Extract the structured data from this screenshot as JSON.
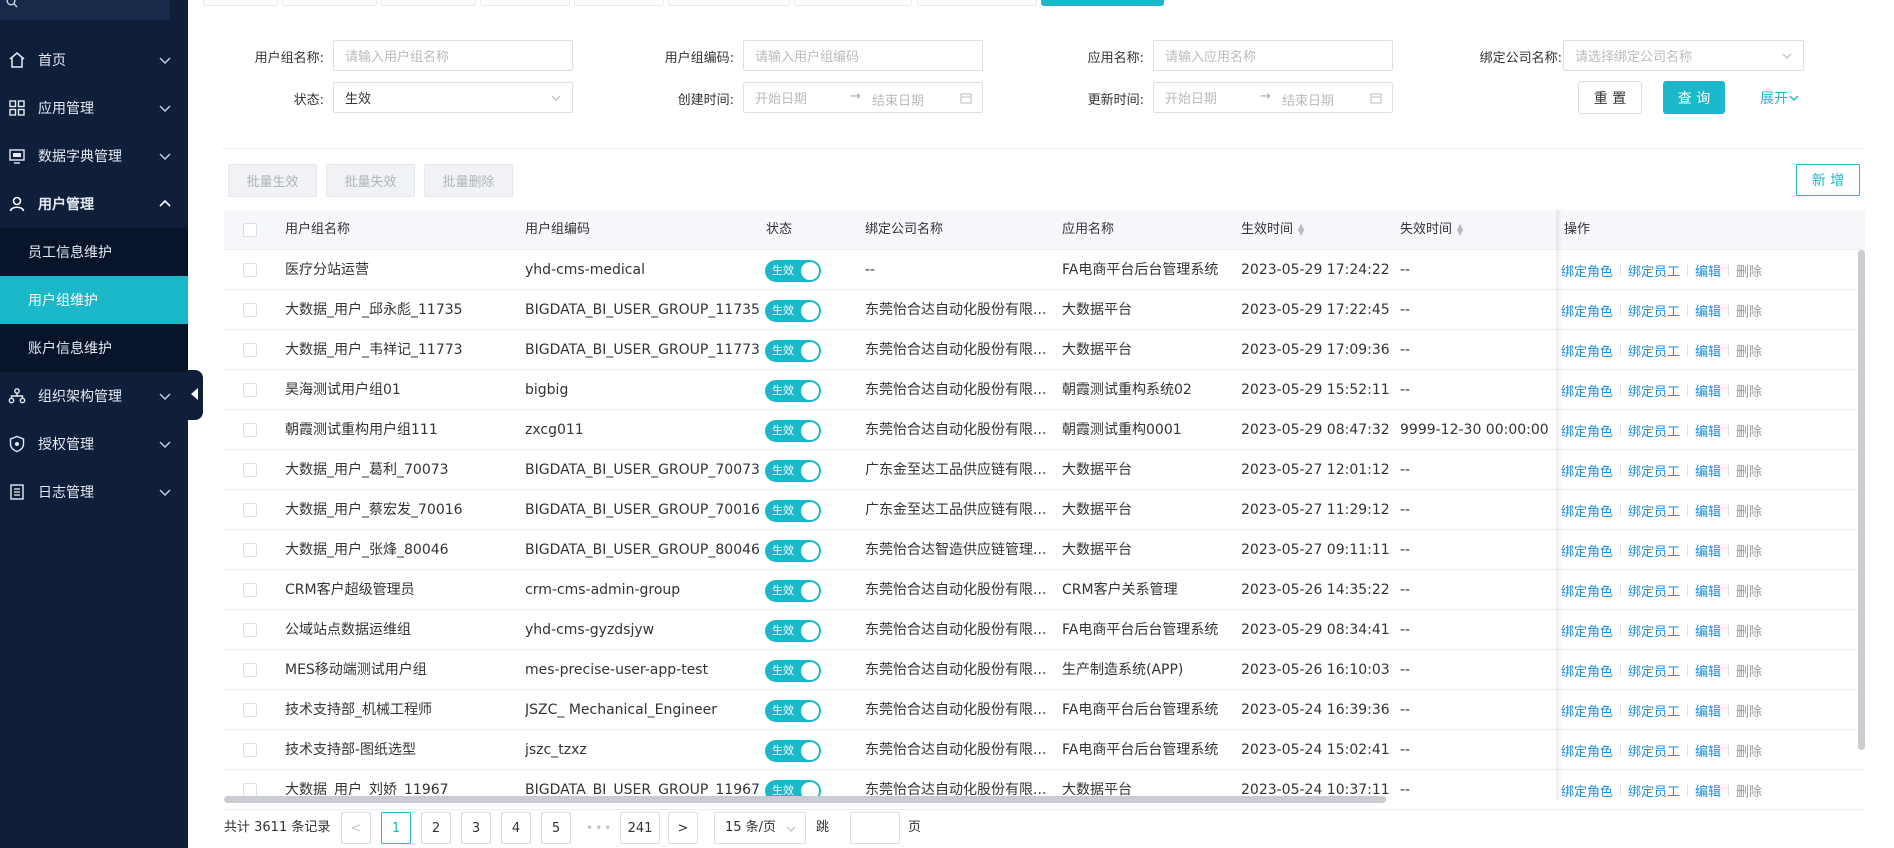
{
  "sidebar": {
    "search_icon": "search-icon",
    "items": [
      {
        "label": "首页",
        "icon": "home-icon"
      },
      {
        "label": "应用管理",
        "icon": "apps-icon"
      },
      {
        "label": "数据字典管理",
        "icon": "monitor-icon"
      },
      {
        "label": "用户管理",
        "icon": "user-icon"
      },
      {
        "label": "组织架构管理",
        "icon": "org-icon"
      },
      {
        "label": "授权管理",
        "icon": "shield-icon"
      },
      {
        "label": "日志管理",
        "icon": "log-icon"
      }
    ],
    "sub_items": [
      {
        "label": "员工信息维护"
      },
      {
        "label": "用户组维护"
      },
      {
        "label": "账户信息维护"
      }
    ]
  },
  "filters": {
    "group_name": {
      "label": "用户组名称:",
      "placeholder": "请输入用户组名称"
    },
    "group_code": {
      "label": "用户组编码:",
      "placeholder": "请输入用户组编码"
    },
    "app_name": {
      "label": "应用名称:",
      "placeholder": "请输入应用名称"
    },
    "company": {
      "label": "绑定公司名称:",
      "placeholder": "请选择绑定公司名称"
    },
    "status": {
      "label": "状态:",
      "value": "生效"
    },
    "created": {
      "label": "创建时间:",
      "start": "开始日期",
      "end": "结束日期"
    },
    "updated": {
      "label": "更新时间:",
      "start": "开始日期",
      "end": "结束日期"
    },
    "reset": "重 置",
    "query": "查 询",
    "expand": "展开"
  },
  "toolbar": {
    "batch_enable": "批量生效",
    "batch_disable": "批量失效",
    "batch_delete": "批量删除",
    "add": "新 增"
  },
  "table": {
    "columns": [
      "用户组名称",
      "用户组编码",
      "状态",
      "绑定公司名称",
      "应用名称",
      "生效时间",
      "失效时间",
      "操作"
    ],
    "actions": {
      "bind_role": "绑定角色",
      "bind_staff": "绑定员工",
      "edit": "编辑",
      "delete": "删除"
    },
    "rows": [
      {
        "name": "医疗分站运营",
        "code": "yhd-cms-medical",
        "status": "生效",
        "company": "--",
        "app": "FA电商平台后台管理系统",
        "start": "2023-05-29 17:24:22",
        "end": "--"
      },
      {
        "name": "大数据_用户_邱永彪_11735",
        "code": "BIGDATA_BI_USER_GROUP_11735",
        "status": "生效",
        "company": "东莞怡合达自动化股份有限...",
        "app": "大数据平台",
        "start": "2023-05-29 17:22:45",
        "end": "--"
      },
      {
        "name": "大数据_用户_韦祥记_11773",
        "code": "BIGDATA_BI_USER_GROUP_11773",
        "status": "生效",
        "company": "东莞怡合达自动化股份有限...",
        "app": "大数据平台",
        "start": "2023-05-29 17:09:36",
        "end": "--"
      },
      {
        "name": "昊海测试用户组01",
        "code": "bigbig",
        "status": "生效",
        "company": "东莞怡合达自动化股份有限...",
        "app": "朝霞测试重构系统02",
        "start": "2023-05-29 15:52:11",
        "end": "--"
      },
      {
        "name": "朝霞测试重构用户组111",
        "code": "zxcg011",
        "status": "生效",
        "company": "东莞怡合达自动化股份有限...",
        "app": "朝霞测试重构0001",
        "start": "2023-05-29 08:47:32",
        "end": "9999-12-30 00:00:00"
      },
      {
        "name": "大数据_用户_葛利_70073",
        "code": "BIGDATA_BI_USER_GROUP_70073",
        "status": "生效",
        "company": "广东金至达工品供应链有限...",
        "app": "大数据平台",
        "start": "2023-05-27 12:01:12",
        "end": "--"
      },
      {
        "name": "大数据_用户_蔡宏发_70016",
        "code": "BIGDATA_BI_USER_GROUP_70016",
        "status": "生效",
        "company": "广东金至达工品供应链有限...",
        "app": "大数据平台",
        "start": "2023-05-27 11:29:12",
        "end": "--"
      },
      {
        "name": "大数据_用户_张烽_80046",
        "code": "BIGDATA_BI_USER_GROUP_80046",
        "status": "生效",
        "company": "东莞怡合达智造供应链管理...",
        "app": "大数据平台",
        "start": "2023-05-27 09:11:11",
        "end": "--"
      },
      {
        "name": "CRM客户超级管理员",
        "code": "crm-cms-admin-group",
        "status": "生效",
        "company": "东莞怡合达自动化股份有限...",
        "app": "CRM客户关系管理",
        "start": "2023-05-26 14:35:22",
        "end": "--"
      },
      {
        "name": "公域站点数据运维组",
        "code": "yhd-cms-gyzdsjyw",
        "status": "生效",
        "company": "东莞怡合达自动化股份有限...",
        "app": "FA电商平台后台管理系统",
        "start": "2023-05-29 08:34:41",
        "end": "--"
      },
      {
        "name": "MES移动端测试用户组",
        "code": "mes-precise-user-app-test",
        "status": "生效",
        "company": "东莞怡合达自动化股份有限...",
        "app": "生产制造系统(APP)",
        "start": "2023-05-26 16:10:03",
        "end": "--"
      },
      {
        "name": "技术支持部_机械工程师",
        "code": "JSZC_ Mechanical_Engineer",
        "status": "生效",
        "company": "东莞怡合达自动化股份有限...",
        "app": "FA电商平台后台管理系统",
        "start": "2023-05-24 16:39:36",
        "end": "--"
      },
      {
        "name": "技术支持部-图纸选型",
        "code": "jszc_tzxz",
        "status": "生效",
        "company": "东莞怡合达自动化股份有限...",
        "app": "FA电商平台后台管理系统",
        "start": "2023-05-24 15:02:41",
        "end": "--"
      },
      {
        "name": "大数据_用户_刘娇_11967",
        "code": "BIGDATA_BI_USER_GROUP_11967",
        "status": "生效",
        "company": "东莞怡合达自动化股份有限...",
        "app": "大数据平台",
        "start": "2023-05-24 10:37:11",
        "end": "--"
      }
    ]
  },
  "pagination": {
    "total": "共计 3611 条记录",
    "pages": [
      "1",
      "2",
      "3",
      "4",
      "5"
    ],
    "ellipsis": "•••",
    "last": "241",
    "prev": "<",
    "next": ">",
    "page_size": "15 条/页",
    "jump_prefix": "跳至",
    "jump_suffix": "页"
  },
  "colors": {
    "accent": "#1bb8c9",
    "sidebar_bg": "#0f1f3a",
    "link": "#1b8fdb"
  }
}
